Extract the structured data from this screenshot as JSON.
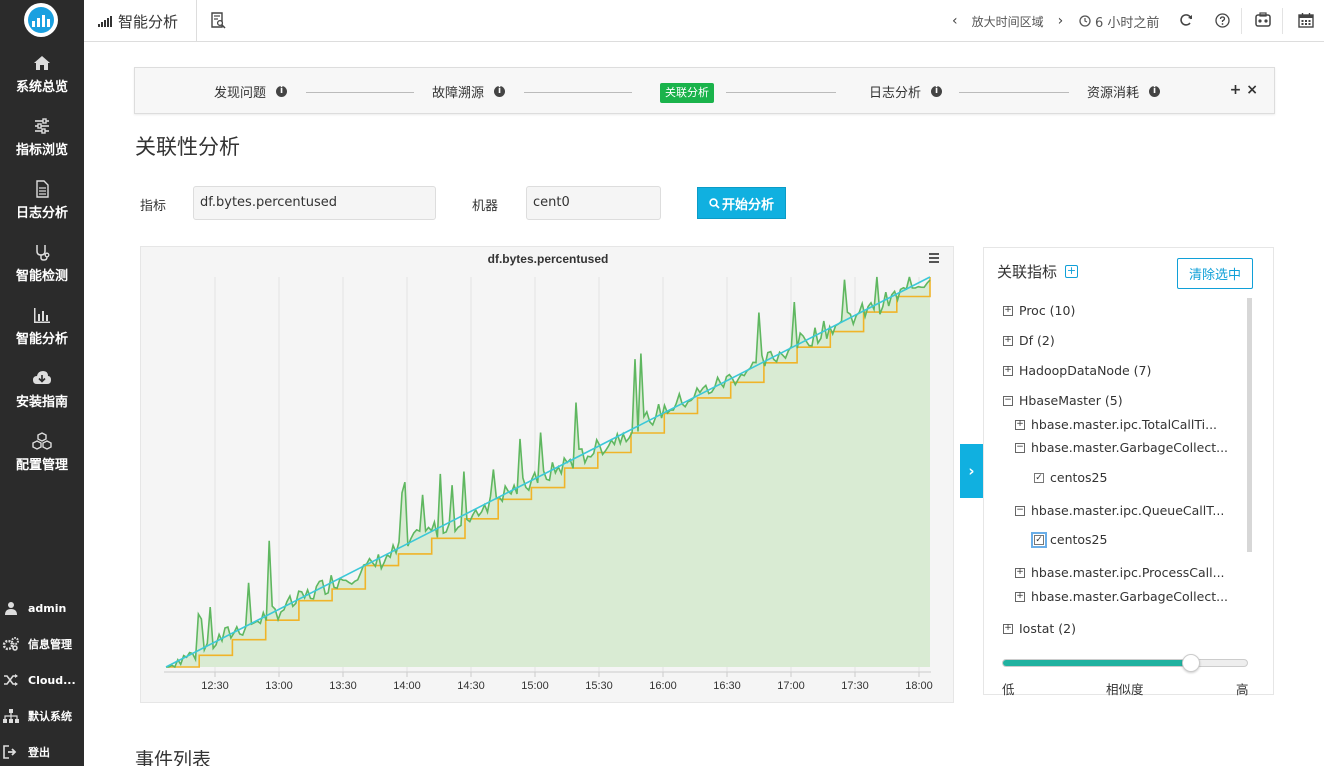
{
  "sidebar": {
    "items": [
      {
        "label": "系统总览",
        "icon": "home-icon"
      },
      {
        "label": "指标浏览",
        "icon": "sliders-icon"
      },
      {
        "label": "日志分析",
        "icon": "file-icon"
      },
      {
        "label": "智能检测",
        "icon": "stethoscope-icon"
      },
      {
        "label": "智能分析",
        "icon": "bar-chart-icon"
      },
      {
        "label": "安装指南",
        "icon": "cloud-download-icon"
      },
      {
        "label": "配置管理",
        "icon": "cubes-icon"
      }
    ],
    "bottom": [
      {
        "label": "admin",
        "icon": "user-icon"
      },
      {
        "label": "信息管理",
        "icon": "gears-icon"
      },
      {
        "label": "Cloud...",
        "icon": "shuffle-icon"
      },
      {
        "label": "默认系统",
        "icon": "sitemap-icon"
      },
      {
        "label": "登出",
        "icon": "sign-out-icon"
      }
    ]
  },
  "header": {
    "title": "智能分析",
    "zoom_label": "放大时间区域",
    "time_label": "6 小时之前"
  },
  "steps": {
    "items": [
      "发现问题",
      "故障溯源",
      "关联分析",
      "日志分析",
      "资源消耗"
    ],
    "active": "关联分析",
    "controls": "+ ×"
  },
  "page": {
    "title": "关联性分析",
    "metric_label": "指标",
    "metric_value": "df.bytes.percentused",
    "machine_label": "机器",
    "machine_value": "cent0",
    "analyze_button": "开始分析",
    "events_title": "事件列表"
  },
  "related": {
    "title": "关联指标",
    "clear_button": "清除选中",
    "tree": [
      {
        "label": "Proc (10)",
        "toggle": "+"
      },
      {
        "label": "Df (2)",
        "toggle": "+"
      },
      {
        "label": "HadoopDataNode (7)",
        "toggle": "+"
      },
      {
        "label": "HbaseMaster (5)",
        "toggle": "−"
      },
      {
        "label": "hbase.master.ipc.TotalCallTi...",
        "toggle": "+"
      },
      {
        "label": "hbase.master.GarbageCollect...",
        "toggle": "−"
      },
      {
        "label": "centos25",
        "checked": true
      },
      {
        "label": "hbase.master.ipc.QueueCallT...",
        "toggle": "−"
      },
      {
        "label": "centos25",
        "checked": true
      },
      {
        "label": "hbase.master.ipc.ProcessCall...",
        "toggle": "+"
      },
      {
        "label": "hbase.master.GarbageCollect...",
        "toggle": "+"
      },
      {
        "label": "Iostat (2)",
        "toggle": "+"
      }
    ],
    "similarity_low": "低",
    "similarity_label": "相似度",
    "similarity_high": "高",
    "similarity_value": 0.77
  },
  "chart_data": {
    "type": "line",
    "title": "df.bytes.percentused",
    "x_ticks": [
      "12:30",
      "13:00",
      "13:30",
      "14:00",
      "14:30",
      "15:00",
      "15:30",
      "16:00",
      "16:30",
      "17:00",
      "17:30",
      "18:00"
    ],
    "x_range": [
      "12:13",
      "18:07"
    ],
    "y_axis_labels": "none shown",
    "series": [
      {
        "color": "#5fb760",
        "style": "noisy area",
        "values": [
          0,
          4,
          9,
          13,
          17,
          22,
          25,
          30,
          35,
          38,
          44,
          47,
          52,
          56,
          61,
          66,
          70,
          74,
          78,
          83,
          87,
          91,
          95,
          100
        ]
      },
      {
        "color": "#f0b429",
        "style": "step",
        "values": [
          0,
          3,
          7,
          12,
          17,
          20,
          26,
          29,
          33,
          38,
          43,
          46,
          51,
          55,
          60,
          65,
          69,
          73,
          78,
          82,
          86,
          91,
          95,
          100
        ]
      },
      {
        "color": "#3cc8d8",
        "style": "trend",
        "values": [
          0,
          100
        ]
      }
    ],
    "area_color": "#d9ebd3",
    "grid": true
  }
}
